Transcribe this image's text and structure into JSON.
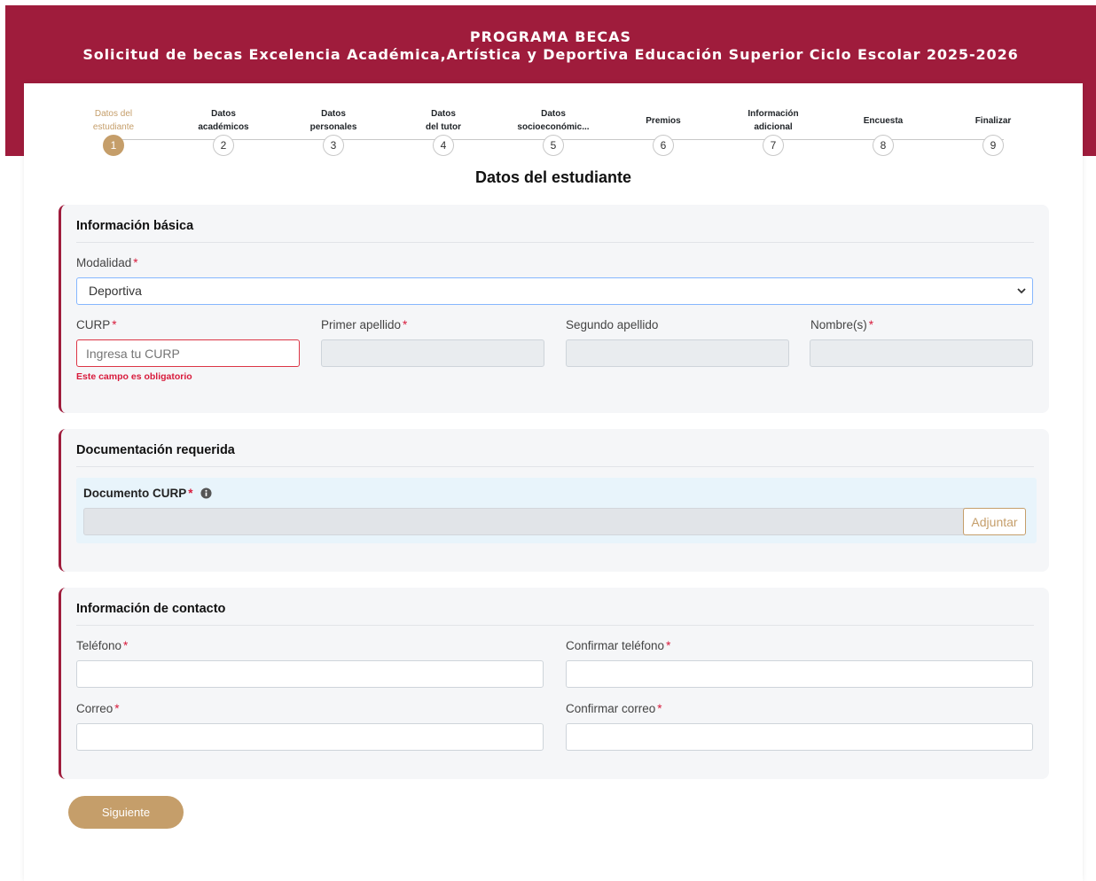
{
  "header": {
    "title": "PROGRAMA BECAS",
    "subtitle": "Solicitud de becas Excelencia Académica,Artística y Deportiva Educación Superior Ciclo Escolar 2025-2026"
  },
  "steps": [
    {
      "line1": "Datos del",
      "line2": "estudiante",
      "number": "1"
    },
    {
      "line1": "Datos",
      "line2": "académicos",
      "number": "2"
    },
    {
      "line1": "Datos",
      "line2": "personales",
      "number": "3"
    },
    {
      "line1": "Datos",
      "line2": "del tutor",
      "number": "4"
    },
    {
      "line1": "Datos",
      "line2": "socioeconómic...",
      "number": "5"
    },
    {
      "line1": "Premios",
      "line2": "",
      "number": "6"
    },
    {
      "line1": "Información",
      "line2": "adicional",
      "number": "7"
    },
    {
      "line1": "Encuesta",
      "line2": "",
      "number": "8"
    },
    {
      "line1": "Finalizar",
      "line2": "",
      "number": "9"
    }
  ],
  "page_title": "Datos del estudiante",
  "basic": {
    "title": "Información básica",
    "modalidad_label": "Modalidad",
    "modalidad_value": "Deportiva",
    "curp_label": "CURP",
    "curp_placeholder": "Ingresa tu CURP",
    "curp_error": "Este campo es obligatorio",
    "primer_apellido_label": "Primer apellido",
    "segundo_apellido_label": "Segundo apellido",
    "nombres_label": "Nombre(s)"
  },
  "docs": {
    "title": "Documentación requerida",
    "curp_doc_label": "Documento CURP",
    "attach_label": "Adjuntar"
  },
  "contact": {
    "title": "Información de contacto",
    "telefono_label": "Teléfono",
    "confirm_telefono_label": "Confirmar teléfono",
    "correo_label": "Correo",
    "confirm_correo_label": "Confirmar correo"
  },
  "required_mark": "*",
  "next_label": "Siguiente"
}
